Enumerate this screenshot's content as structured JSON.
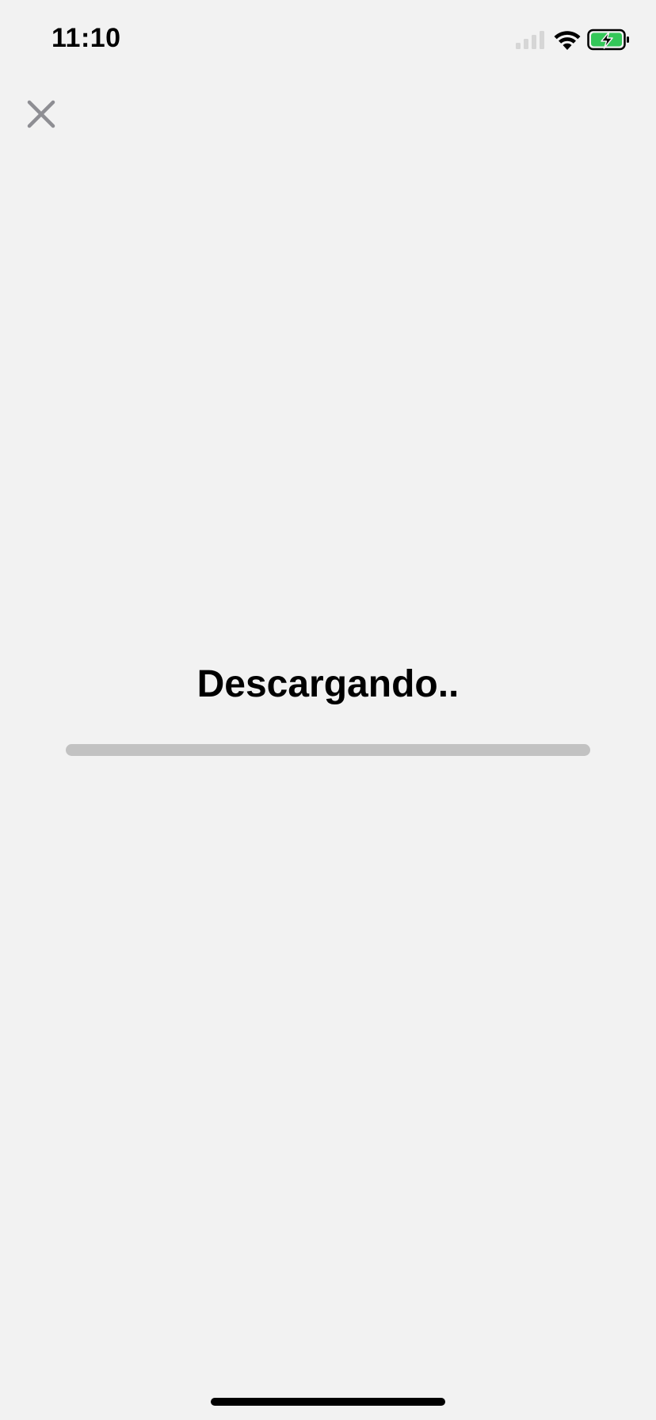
{
  "status_bar": {
    "time": "11:10",
    "signal_icon": "cellular-signal-icon",
    "wifi_icon": "wifi-icon",
    "battery_icon": "battery-charging-icon",
    "battery_color": "#34c759"
  },
  "header": {
    "close_icon": "close-icon",
    "close_color": "#8e8e93"
  },
  "download": {
    "title": "Descargando..",
    "progress": 0,
    "track_color": "#c2c2c2"
  }
}
